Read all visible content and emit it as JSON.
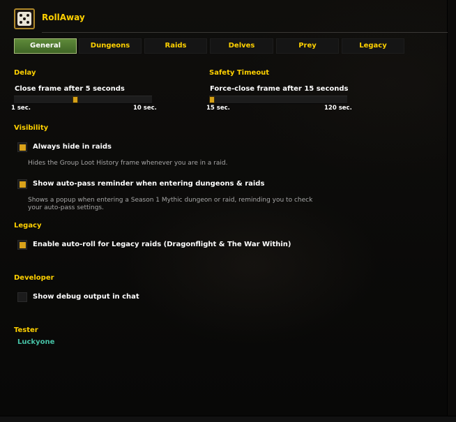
{
  "header": {
    "title": "RollAway"
  },
  "tabs": [
    {
      "label": "General",
      "active": true
    },
    {
      "label": "Dungeons",
      "active": false
    },
    {
      "label": "Raids",
      "active": false
    },
    {
      "label": "Delves",
      "active": false
    },
    {
      "label": "Prey",
      "active": false
    },
    {
      "label": "Legacy",
      "active": false
    }
  ],
  "delay": {
    "section": "Delay",
    "label": "Close frame after 5 seconds",
    "min_label": "1 sec.",
    "max_label": "10 sec.",
    "value": 5,
    "min": 1,
    "max": 10
  },
  "safety": {
    "section": "Safety Timeout",
    "label": "Force-close frame after 15 seconds",
    "min_label": "15 sec.",
    "max_label": "120 sec.",
    "value": 15,
    "min": 15,
    "max": 120
  },
  "visibility": {
    "section": "Visibility",
    "always_hide": {
      "label": "Always hide in raids",
      "checked": true,
      "description": "Hides the Group Loot History frame whenever you are in a raid."
    },
    "reminder": {
      "label": "Show auto-pass reminder when entering dungeons & raids",
      "checked": true,
      "description_line1": "Shows a popup when entering a Season 1 Mythic dungeon or raid, reminding you to check",
      "description_line2": "your auto-pass settings."
    }
  },
  "legacy": {
    "section": "Legacy",
    "auto_roll": {
      "label": "Enable auto-roll for Legacy raids (Dragonflight & The War Within)",
      "checked": true
    }
  },
  "developer": {
    "section": "Developer",
    "debug": {
      "label": "Show debug output in chat",
      "checked": false
    }
  },
  "tester": {
    "section": "Tester",
    "name": "Luckyone"
  },
  "colors": {
    "gold": "#ffd100",
    "checkbox_fill": "#d9a21a",
    "active_tab": "#4f7a30",
    "tester_name": "#46c2a6",
    "description": "#a8a8a8"
  }
}
